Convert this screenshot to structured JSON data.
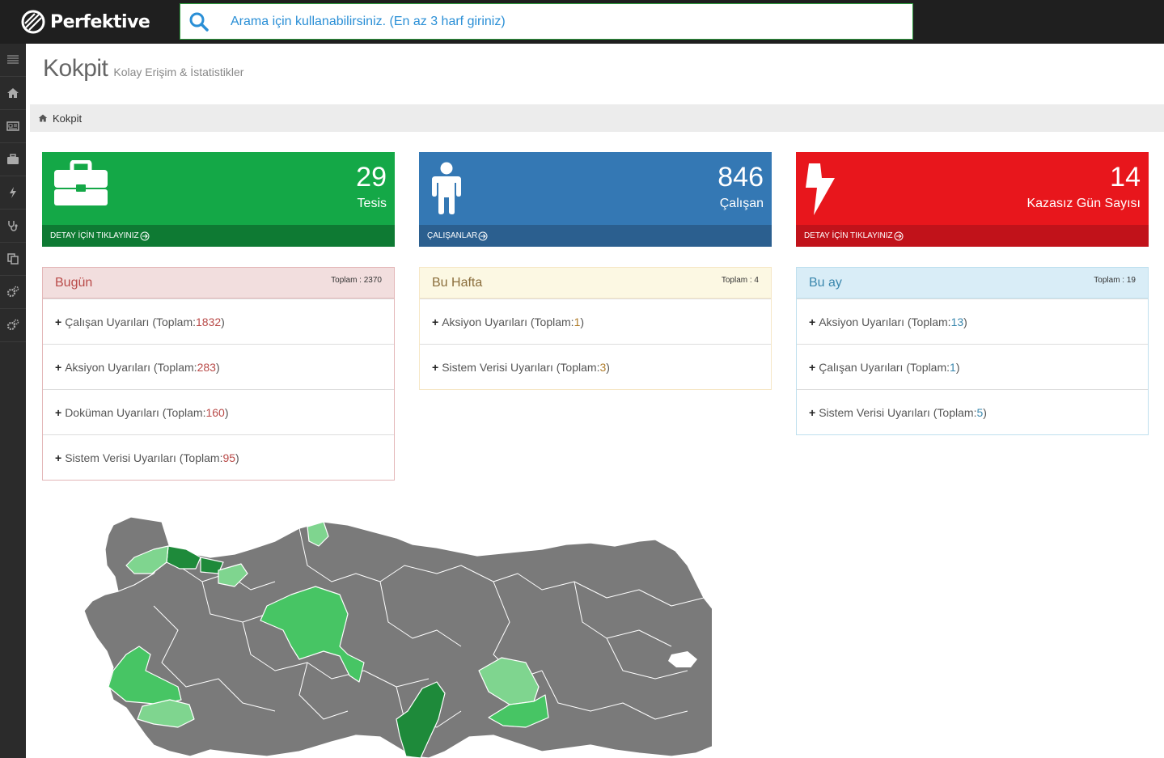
{
  "app": {
    "brand": "Perfektive"
  },
  "search": {
    "placeholder": "Arama için kullanabilirsiniz. (En az 3 harf giriniz)"
  },
  "sidebar": {
    "items": [
      "menu-icon",
      "home-icon",
      "newspaper-icon",
      "briefcase-icon",
      "bolt-icon",
      "stethoscope-icon",
      "copy-icon",
      "gears-icon",
      "gears-icon"
    ]
  },
  "page": {
    "title": "Kokpit",
    "subtitle": "Kolay Erişim & İstatistikler"
  },
  "breadcrumb": {
    "label": "Kokpit"
  },
  "tiles": [
    {
      "value": "29",
      "label": "Tesis",
      "footer": "DETAY İÇİN TIKLAYINIZ",
      "color": "#14a847",
      "icon": "briefcase-icon"
    },
    {
      "value": "846",
      "label": "Çalışan",
      "footer": "ÇALIŞANLAR",
      "color": "#3478b4",
      "icon": "person-icon"
    },
    {
      "value": "14",
      "label": "Kazasız Gün Sayısı",
      "footer": "DETAY İÇİN TIKLAYINIZ",
      "color": "#e8161c",
      "icon": "bolt-icon"
    }
  ],
  "panels": {
    "today": {
      "title": "Bugün",
      "total": "Toplam : 2370",
      "rows": [
        {
          "text": "Çalışan Uyarıları (Toplam: ",
          "count": "1832",
          "close": ")"
        },
        {
          "text": "Aksiyon Uyarıları (Toplam: ",
          "count": "283",
          "close": ")"
        },
        {
          "text": "Doküman Uyarıları (Toplam: ",
          "count": "160",
          "close": ")"
        },
        {
          "text": "Sistem Verisi Uyarıları (Toplam: ",
          "count": "95",
          "close": ")"
        }
      ]
    },
    "week": {
      "title": "Bu Hafta",
      "total": "Toplam : 4",
      "rows": [
        {
          "text": "Aksiyon Uyarıları (Toplam: ",
          "count": "1",
          "close": ")"
        },
        {
          "text": "Sistem Verisi Uyarıları (Toplam: ",
          "count": "3",
          "close": ")"
        }
      ]
    },
    "month": {
      "title": "Bu ay",
      "total": "Toplam : 19",
      "rows": [
        {
          "text": "Aksiyon Uyarıları (Toplam: ",
          "count": "13",
          "close": ")"
        },
        {
          "text": "Çalışan Uyarıları (Toplam: ",
          "count": "1",
          "close": ")"
        },
        {
          "text": "Sistem Verisi Uyarıları (Toplam: ",
          "count": "5",
          "close": ")"
        }
      ]
    }
  },
  "map": {
    "base_color": "#7a7a7a",
    "highlight_colors": [
      "#1e8a3a",
      "#47c564",
      "#7fd58f"
    ]
  }
}
